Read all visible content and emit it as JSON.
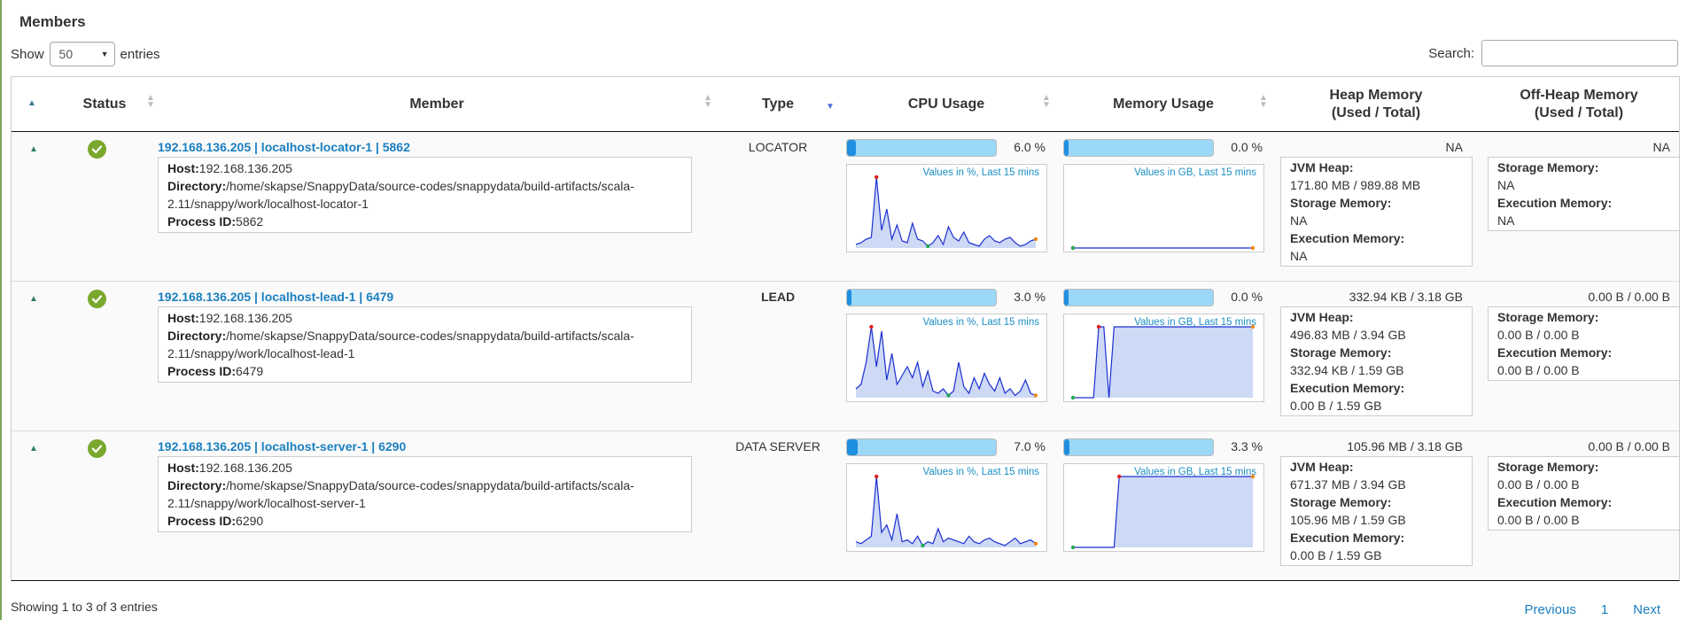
{
  "section_title": "Members",
  "length_menu": {
    "show_label": "Show",
    "selected": "50",
    "entries_label": "entries"
  },
  "search": {
    "label": "Search:",
    "value": ""
  },
  "columns": {
    "status": "Status",
    "member": "Member",
    "type": "Type",
    "cpu": "CPU Usage",
    "memory": "Memory Usage",
    "heap_line1": "Heap Memory",
    "heap_line2": "(Used / Total)",
    "offheap_line1": "Off-Heap Memory",
    "offheap_line2": "(Used / Total)"
  },
  "labels": {
    "host": "Host:",
    "directory": "Directory:",
    "process_id": "Process ID:",
    "jvm_heap": "JVM Heap:",
    "storage_memory": "Storage Memory:",
    "execution_memory": "Execution Memory:",
    "cpu_caption": "Values in %, Last 15 mins",
    "mem_caption": "Values in GB, Last 15 mins"
  },
  "colors": {
    "accent": "#1a7fc0",
    "status_ok": "#7aa82d",
    "spark_line": "#1a2fd0",
    "spark_fill": "#cdd9f5",
    "max_dot": "#e02020",
    "min_dot": "#22aa55",
    "last_dot": "#f08a1a"
  },
  "members": [
    {
      "title": "192.168.136.205 | localhost-locator-1 | 5862",
      "host": "192.168.136.205",
      "directory_line1": "/home/skapse/SnappyData/source-codes/snappydata/build-artifacts/scala-",
      "directory_line2": "2.11/snappy/work/localhost-locator-1",
      "process_id": "5862",
      "type": "LOCATOR",
      "type_bold": false,
      "cpu_pct": 6.0,
      "cpu_label": "6.0 %",
      "mem_pct": 0.0,
      "mem_label": "0.0 %",
      "heap_summary": "NA",
      "jvm_heap": "171.80 MB / 989.88 MB",
      "storage_memory": "NA",
      "execution_memory": "NA",
      "offheap_summary": "NA",
      "offheap_storage": "NA",
      "offheap_execution": "NA",
      "cpu_series": [
        2,
        3,
        5,
        6,
        40,
        10,
        22,
        5,
        13,
        4,
        3,
        14,
        5,
        4,
        1,
        3,
        7,
        2,
        12,
        6,
        4,
        9,
        3,
        2,
        1,
        5,
        7,
        4,
        3,
        5,
        6,
        3,
        1,
        2,
        4,
        5
      ],
      "mem_series": [
        0,
        0,
        0,
        0,
        0,
        0,
        0,
        0,
        0,
        0,
        0,
        0,
        0,
        0,
        0,
        0,
        0,
        0,
        0,
        0,
        0,
        0,
        0,
        0,
        0,
        0,
        0,
        0,
        0,
        0,
        0,
        0,
        0,
        0,
        0,
        0
      ],
      "mem_ylim": [
        0,
        1
      ]
    },
    {
      "title": "192.168.136.205 | localhost-lead-1 | 6479",
      "host": "192.168.136.205",
      "directory_line1": "/home/skapse/SnappyData/source-codes/snappydata/build-artifacts/scala-",
      "directory_line2": "2.11/snappy/work/localhost-lead-1",
      "process_id": "6479",
      "type": "LEAD",
      "type_bold": true,
      "cpu_pct": 3.0,
      "cpu_label": "3.0 %",
      "mem_pct": 0.0,
      "mem_label": "0.0 %",
      "heap_summary": "332.94 KB / 3.18 GB",
      "jvm_heap": "496.83 MB / 3.94 GB",
      "storage_memory": "332.94 KB / 1.59 GB",
      "execution_memory": "0.00 B / 1.59 GB",
      "offheap_summary": "0.00 B / 0.00 B",
      "offheap_storage": "0.00 B / 0.00 B",
      "offheap_execution": "0.00 B / 0.00 B",
      "cpu_series": [
        4,
        6,
        16,
        32,
        14,
        30,
        8,
        20,
        6,
        10,
        14,
        9,
        16,
        5,
        12,
        3,
        2,
        4,
        1,
        3,
        16,
        5,
        2,
        9,
        4,
        11,
        6,
        3,
        9,
        2,
        4,
        1,
        3,
        8,
        2,
        1
      ],
      "mem_series": [
        0,
        0,
        0,
        0,
        0,
        0.001,
        0.001,
        0.0,
        0.001,
        0.001,
        0.001,
        0.001,
        0.001,
        0.001,
        0.001,
        0.001,
        0.001,
        0.001,
        0.001,
        0.001,
        0.001,
        0.001,
        0.001,
        0.001,
        0.001,
        0.001,
        0.001,
        0.001,
        0.001,
        0.001,
        0.001,
        0.001,
        0.001,
        0.001,
        0.001,
        0.001
      ],
      "mem_ylim": [
        0,
        0.001
      ]
    },
    {
      "title": "192.168.136.205 | localhost-server-1 | 6290",
      "host": "192.168.136.205",
      "directory_line1": "/home/skapse/SnappyData/source-codes/snappydata/build-artifacts/scala-",
      "directory_line2": "2.11/snappy/work/localhost-server-1",
      "process_id": "6290",
      "type": "DATA SERVER",
      "type_bold": false,
      "cpu_pct": 7.0,
      "cpu_label": "7.0 %",
      "mem_pct": 3.3,
      "mem_label": "3.3 %",
      "heap_summary": "105.96 MB / 3.18 GB",
      "jvm_heap": "671.37 MB / 3.94 GB",
      "storage_memory": "105.96 MB / 1.59 GB",
      "execution_memory": "0.00 B / 1.59 GB",
      "offheap_summary": "0.00 B / 0.00 B",
      "offheap_storage": "0.00 B / 0.00 B",
      "offheap_execution": "0.00 B / 0.00 B",
      "cpu_series": [
        3,
        2,
        4,
        6,
        38,
        8,
        12,
        4,
        18,
        3,
        4,
        2,
        6,
        1,
        3,
        2,
        10,
        3,
        5,
        4,
        3,
        2,
        6,
        3,
        2,
        4,
        5,
        3,
        2,
        1,
        3,
        5,
        2,
        3,
        4,
        2
      ],
      "mem_series": [
        0,
        0,
        0,
        0,
        0,
        0,
        0,
        0,
        0,
        0.106,
        0.106,
        0.106,
        0.106,
        0.106,
        0.106,
        0.106,
        0.106,
        0.106,
        0.106,
        0.106,
        0.106,
        0.106,
        0.106,
        0.106,
        0.106,
        0.106,
        0.106,
        0.106,
        0.106,
        0.106,
        0.106,
        0.106,
        0.106,
        0.106,
        0.106,
        0.106
      ],
      "mem_ylim": [
        0,
        0.106
      ]
    }
  ],
  "footer": {
    "info": "Showing 1 to 3 of 3 entries",
    "previous": "Previous",
    "page": "1",
    "next": "Next"
  }
}
